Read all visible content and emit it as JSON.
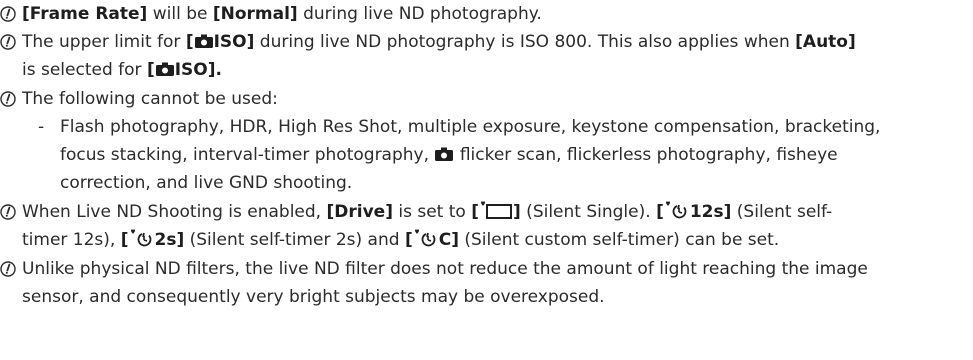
{
  "notes": [
    {
      "part1_bold": "[Frame Rate]",
      "part2": " will be ",
      "part3_bold": "[Normal]",
      "part4": " during live ND photography."
    },
    {
      "part1": "The upper limit for ",
      "bold_open": "[",
      "bold_iso": "ISO]",
      "part2": " during live ND photography is ISO 800. This also applies when ",
      "bold_auto": "[Auto]",
      "line2_pre": "is selected for ",
      "line2_bold_open": "[",
      "line2_bold_iso": "ISO]",
      "line2_end": "."
    },
    {
      "text": "The following cannot be used:",
      "sub": [
        "Flash photography, HDR, High Res Shot, multiple exposure, keystone compensation, bracketing,",
        "focus stacking, interval-timer photography, ",
        " flicker scan, flickerless photography, fisheye",
        "correction, and live GND shooting."
      ]
    },
    {
      "part1": "When Live ND Shooting is enabled, ",
      "bold_drive": "[Drive]",
      "part2": " is set to ",
      "silent_single_open": "[",
      "silent_single_close": "]",
      "part3": " (Silent Single). ",
      "st12_open": "[",
      "st12_label": "12s]",
      "part4": " (Silent self-",
      "line2_part1": "timer 12s), ",
      "st2_open": "[",
      "st2_label": "2s]",
      "line2_part2": " (Silent self-timer 2s) and ",
      "stc_open": "[",
      "stc_label": "C]",
      "line2_part3": " (Silent custom self-timer) can be set."
    },
    {
      "line1": "Unlike physical ND filters, the live ND filter does not reduce the amount of light reaching the image",
      "line2": "sensor, and consequently very bright subjects may be overexposed."
    }
  ],
  "icons": {
    "note_icon": "caution-circle-icon",
    "camera": "camera-icon",
    "silent_single": "silent-single-frame-icon",
    "silent_timer": "silent-self-timer-icon"
  },
  "colors": {
    "text": "#2b2b2b",
    "icon": "#2b2b2b"
  }
}
